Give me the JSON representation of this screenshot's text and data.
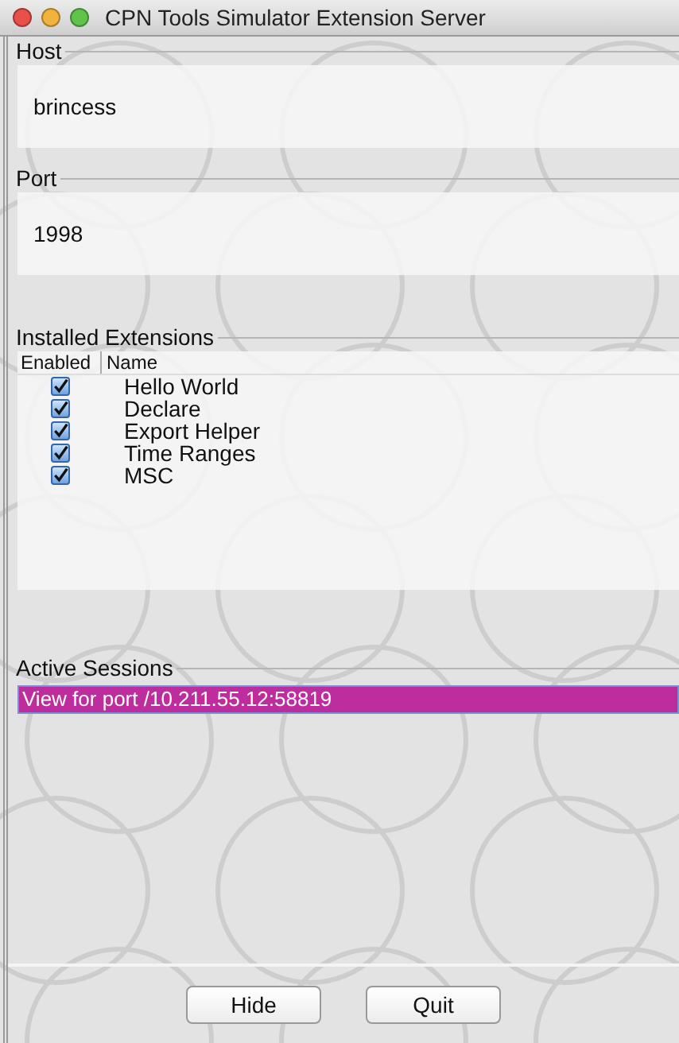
{
  "window": {
    "title": "CPN Tools Simulator Extension Server"
  },
  "host": {
    "label": "Host",
    "value": "brincess"
  },
  "port": {
    "label": "Port",
    "value": "1998"
  },
  "extensions": {
    "title": "Installed Extensions",
    "columns": [
      "Enabled",
      "Name"
    ],
    "rows": [
      {
        "enabled": true,
        "name": "Hello World"
      },
      {
        "enabled": true,
        "name": "Declare"
      },
      {
        "enabled": true,
        "name": "Export Helper"
      },
      {
        "enabled": true,
        "name": "Time Ranges"
      },
      {
        "enabled": true,
        "name": "MSC"
      }
    ]
  },
  "sessions": {
    "title": "Active Sessions",
    "items": [
      {
        "label": "View for port /10.211.55.12:58819",
        "selected": true
      }
    ]
  },
  "buttons": [
    "Hide",
    "Quit"
  ]
}
